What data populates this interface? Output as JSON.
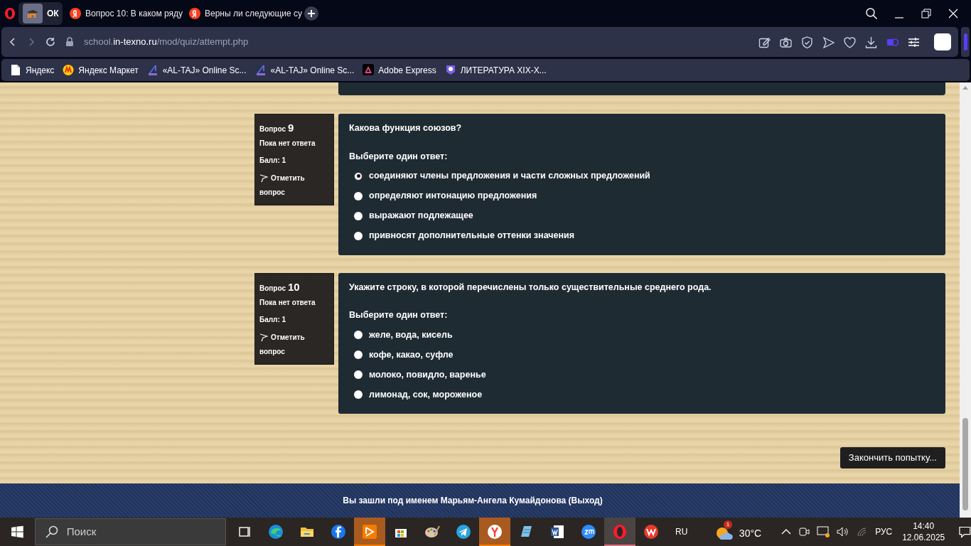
{
  "browser": {
    "tabs": [
      {
        "title": "ОК",
        "selected": true
      },
      {
        "title": "Вопрос 10: В каком ряду",
        "selected": false
      },
      {
        "title": "Верны ли следующие су",
        "selected": false
      }
    ],
    "address": {
      "subdomain": "school.",
      "domain": "in-texno.ru",
      "path": "/mod/quiz/attempt.php"
    },
    "bookmarks": [
      "Яндекс",
      "Яндекс Маркет",
      "«AL-TAJ» Online Sc...",
      "«AL-TAJ» Online Sc...",
      "Adobe Express",
      "ЛИТЕРАТУРА XIX-X..."
    ]
  },
  "questions": [
    {
      "label": "Вопрос",
      "number": "9",
      "status": "Пока нет ответа",
      "score": "Балл: 1",
      "flag": "Отметить вопрос",
      "text": "Какова функция союзов?",
      "prompt": "Выберите один ответ:",
      "options": [
        {
          "text": "соединяют члены предложения и части сложных предложений",
          "selected": true
        },
        {
          "text": "определяют интонацию предложения",
          "selected": false
        },
        {
          "text": "выражают подлежащее",
          "selected": false
        },
        {
          "text": "привносят дополнительные оттенки значения",
          "selected": false
        }
      ]
    },
    {
      "label": "Вопрос",
      "number": "10",
      "status": "Пока нет ответа",
      "score": "Балл: 1",
      "flag": "Отметить вопрос",
      "text": "Укажите строку, в которой перечислены только существительные среднего рода.",
      "prompt": "Выберите один ответ:",
      "options": [
        {
          "text": "желе, вода, кисель",
          "selected": false
        },
        {
          "text": "кофе, какао, суфле",
          "selected": false
        },
        {
          "text": "молоко, повидло, варенье",
          "selected": false
        },
        {
          "text": "лимонад, сок, мороженое",
          "selected": false
        }
      ]
    }
  ],
  "finish_button": "Закончить попытку...",
  "footer": "Вы зашли под именем Марьям-Ангела Кумайдонова (Выход)",
  "taskbar": {
    "search_placeholder": "Поиск",
    "apps": [
      {
        "highlighted": false,
        "open": false
      },
      {
        "highlighted": false,
        "open": false
      },
      {
        "highlighted": false,
        "open": false
      },
      {
        "highlighted": false,
        "open": false
      },
      {
        "highlighted": true,
        "open": true
      },
      {
        "highlighted": false,
        "open": false
      },
      {
        "highlighted": false,
        "open": false
      },
      {
        "highlighted": false,
        "open": false
      },
      {
        "highlighted": true,
        "open": true
      },
      {
        "highlighted": false,
        "open": false
      },
      {
        "highlighted": false,
        "open": false
      },
      {
        "highlighted": false,
        "open": false
      },
      {
        "highlighted": false,
        "open": true
      },
      {
        "highlighted": false,
        "open": false
      }
    ],
    "language": "RU",
    "weather_badge": "1",
    "temperature": "30°C",
    "input_language": "РУС",
    "time": "14:40",
    "date": "12.06.2025"
  }
}
